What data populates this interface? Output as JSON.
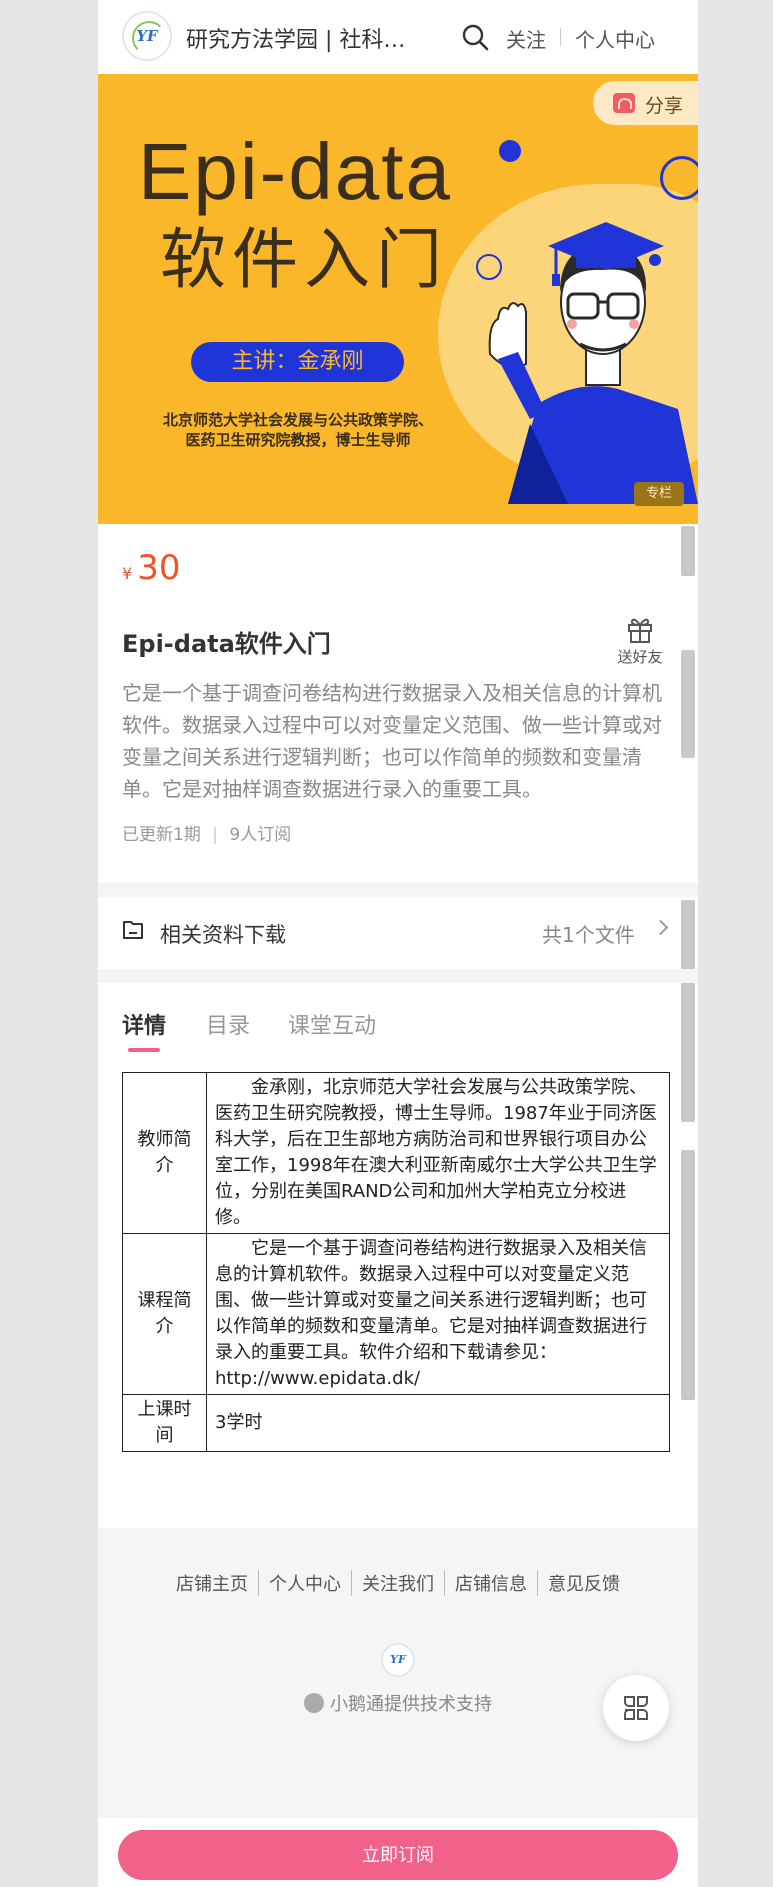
{
  "header": {
    "title": "研究方法学园 | 社科方法与统计",
    "logo_text": "YF",
    "follow_label": "关注",
    "user_center_label": "个人中心"
  },
  "banner": {
    "share_label": "分享",
    "title_en": "Epi-data",
    "title_cn": "软件入门",
    "speaker": "主讲：金承刚",
    "institution_line1": "北京师范大学社会发展与公共政策学院、",
    "institution_line2": "医药卫生研究院教授，博士生导师",
    "tag": "专栏",
    "bg_color": "#fbb72a",
    "accent_color": "#1f35d8"
  },
  "course": {
    "currency": "¥",
    "price": "30",
    "title": "Epi-data软件入门",
    "gift_label": "送好友",
    "description": "它是一个基于调查问卷结构进行数据录入及相关信息的计算机软件。数据录入过程中可以对变量定义范围、做一些计算或对变量之间关系进行逻辑判断；也可以作简单的频数和变量清单。它是对抽样调查数据进行录入的重要工具。",
    "updates": "已更新1期",
    "subscribers": "9人订阅",
    "price_color": "#f0522a"
  },
  "download": {
    "label": "相关资料下载",
    "count": "共1个文件"
  },
  "tabs": [
    {
      "label": "详情"
    },
    {
      "label": "目录"
    },
    {
      "label": "课堂互动"
    }
  ],
  "details": {
    "rows": [
      {
        "key": "教师简介",
        "value": "金承刚，北京师范大学社会发展与公共政策学院、医药卫生研究院教授，博士生导师。1987年业于同济医科大学，后在卫生部地方病防治司和世界银行项目办公室工作，1998年在澳大利亚新南威尔士大学公共卫生学位，分别在美国RAND公司和加州大学柏克立分校进修。"
      },
      {
        "key": "课程简介",
        "value": "它是一个基于调查问卷结构进行数据录入及相关信息的计算机软件。数据录入过程中可以对变量定义范围、做一些计算或对变量之间关系进行逻辑判断；也可以作简单的频数和变量清单。它是对抽样调查数据进行录入的重要工具。软件介绍和下载请参见：http://www.epidata.dk/"
      },
      {
        "key": "上课时间",
        "value": "3学时"
      }
    ]
  },
  "footer": {
    "links": [
      "店铺主页",
      "个人中心",
      "关注我们",
      "店铺信息",
      "意见反馈"
    ],
    "tech_support": "小鹅通提供技术支持"
  },
  "subscribe_button": "立即订阅",
  "button_color": "#f2618a"
}
